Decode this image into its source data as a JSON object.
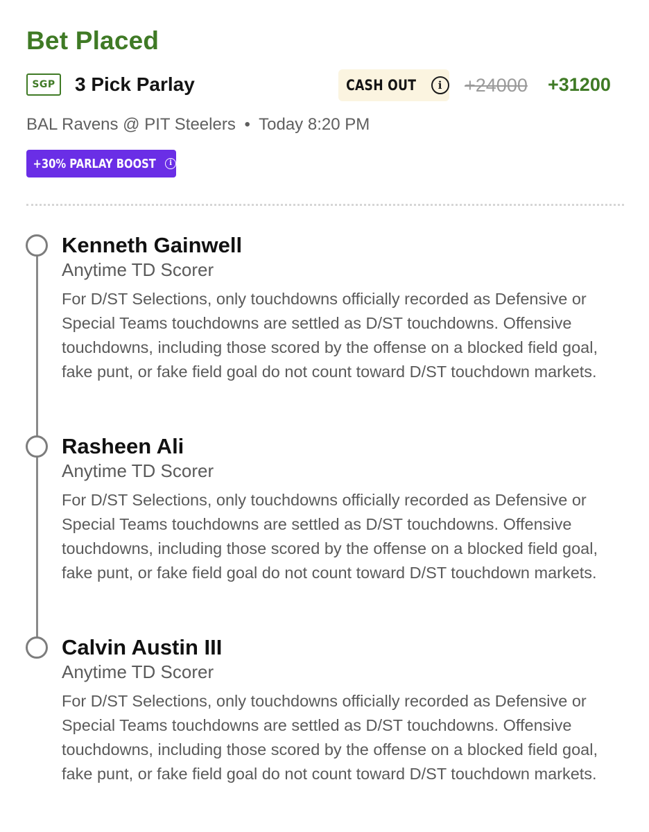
{
  "status": "Bet Placed",
  "bet": {
    "badge": "SGP",
    "type": "3 Pick Parlay",
    "cash_out_label": "CASH OUT",
    "original_odds": "+24000",
    "boosted_odds": "+31200"
  },
  "game": {
    "matchup": "BAL Ravens @ PIT Steelers",
    "separator": "•",
    "time": "Today 8:20 PM"
  },
  "boost": {
    "label": "+30% PARLAY BOOST"
  },
  "legs": [
    {
      "player": "Kenneth Gainwell",
      "market": "Anytime TD Scorer",
      "description": "For D/ST Selections, only touchdowns officially recorded as Defensive or Special Teams touchdowns are settled as D/ST touchdowns. Offensive touchdowns, including those scored by the offense on a blocked field goal, fake punt, or fake field goal do not count toward D/ST touchdown markets."
    },
    {
      "player": "Rasheen Ali",
      "market": "Anytime TD Scorer",
      "description": "For D/ST Selections, only touchdowns officially recorded as Defensive or Special Teams touchdowns are settled as D/ST touchdowns. Offensive touchdowns, including those scored by the offense on a blocked field goal, fake punt, or fake field goal do not count toward D/ST touchdown markets."
    },
    {
      "player": "Calvin Austin III",
      "market": "Anytime TD Scorer",
      "description": "For D/ST Selections, only touchdowns officially recorded as Defensive or Special Teams touchdowns are settled as D/ST touchdowns. Offensive touchdowns, including those scored by the offense on a blocked field goal, fake punt, or fake field goal do not count toward D/ST touchdown markets."
    }
  ],
  "icons": {
    "cash_out_info": "info-icon",
    "boost_info": "info-icon",
    "leg_status": "empty-circle-icon"
  },
  "colors": {
    "brand_green": "#3f7a25",
    "boost_purple": "#6a2ee6",
    "cash_out_bg": "#fbf4e0",
    "muted_text": "#5a5a5a"
  }
}
